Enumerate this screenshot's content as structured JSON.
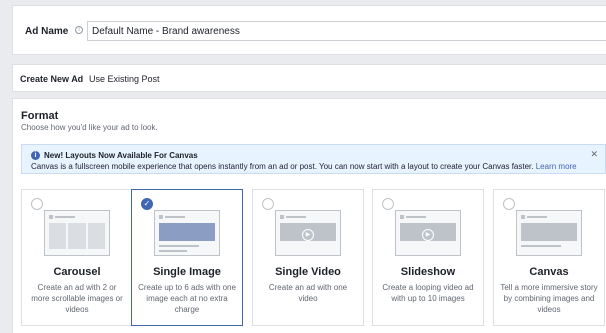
{
  "ad_name": {
    "label": "Ad Name",
    "info_icon": "info-icon",
    "value": "Default Name - Brand awareness"
  },
  "tabs": {
    "create_new": "Create New Ad",
    "use_existing": "Use Existing Post"
  },
  "format": {
    "title": "Format",
    "subtitle": "Choose how you'd like your ad to look.",
    "banner": {
      "title": "New! Layouts Now Available For Canvas",
      "body": "Canvas is a fullscreen mobile experience that opens instantly from an ad or post. You can now start with a layout to create your Canvas faster. ",
      "link": "Learn more",
      "close_icon": "close-icon"
    },
    "cards": [
      {
        "title": "Carousel",
        "desc": "Create an ad with 2 or more scrollable images or videos",
        "selected": false
      },
      {
        "title": "Single Image",
        "desc": "Create up to 6 ads with one image each at no extra charge",
        "selected": true
      },
      {
        "title": "Single Video",
        "desc": "Create an ad with one video",
        "selected": false
      },
      {
        "title": "Slideshow",
        "desc": "Create a looping video ad with up to 10 images",
        "selected": false
      },
      {
        "title": "Canvas",
        "desc": "Tell a more immersive story by combining images and videos",
        "selected": false
      }
    ]
  },
  "colors": {
    "accent": "#4267b2",
    "banner_bg": "#e7f3ff"
  }
}
